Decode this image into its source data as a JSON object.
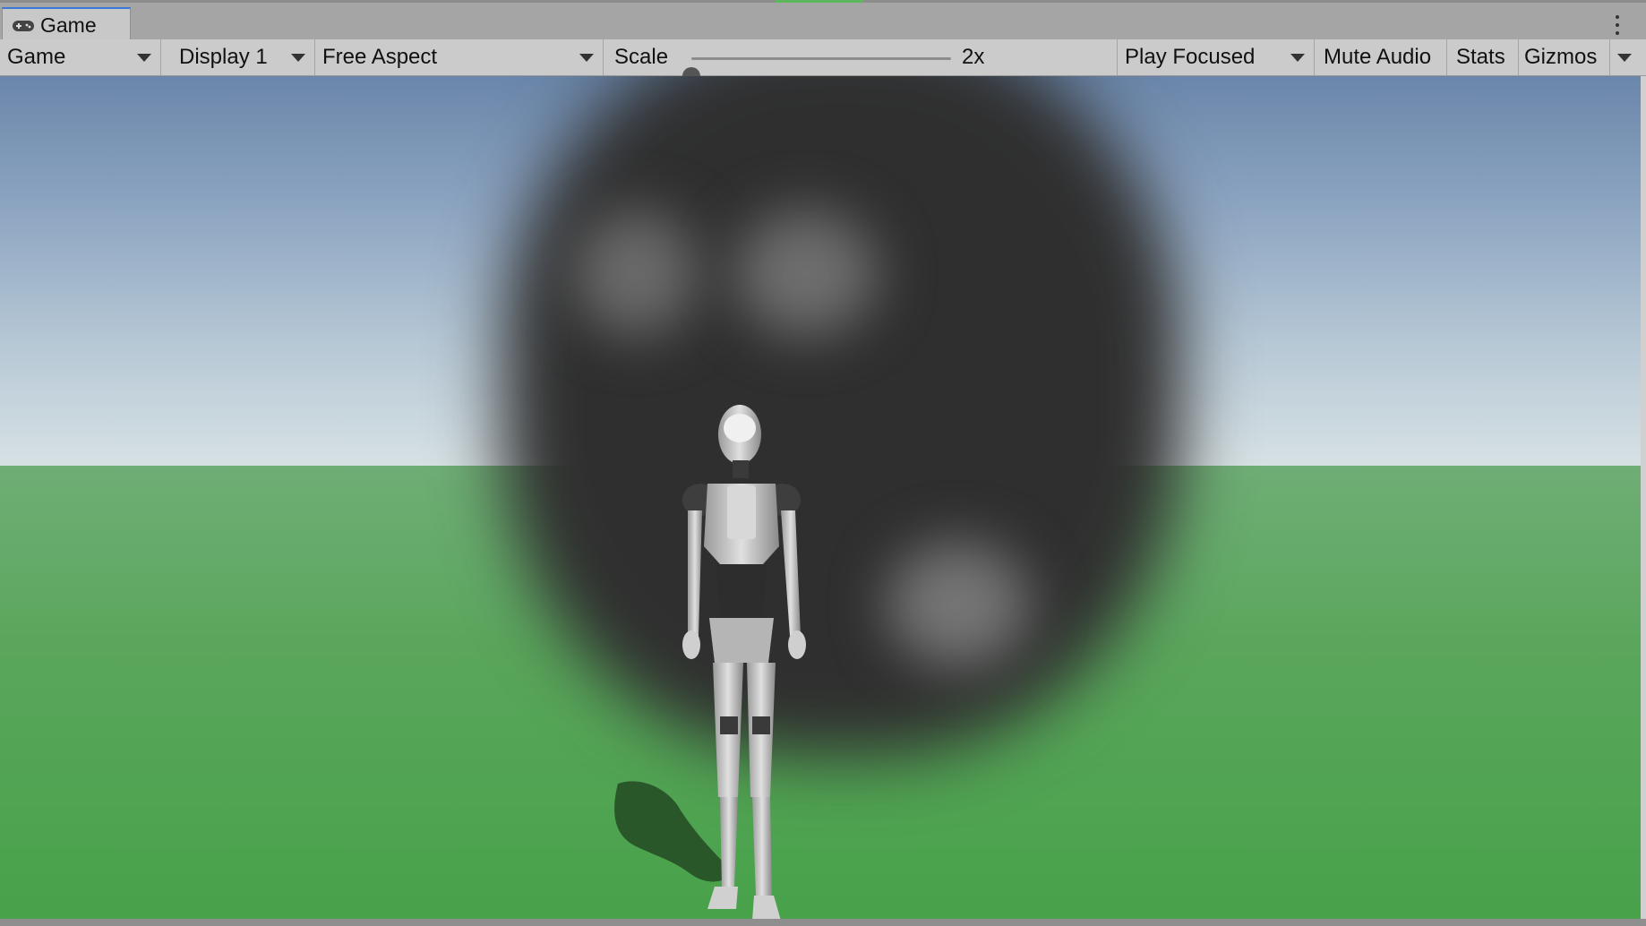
{
  "tab": {
    "label": "Game",
    "icon": "gamepad-icon"
  },
  "menu": {
    "icon": "kebab-menu-icon"
  },
  "toolbar": {
    "view_mode": "Game",
    "display": "Display 1",
    "aspect": "Free Aspect",
    "scale_label": "Scale",
    "scale_value": "2x",
    "scale_fraction": 0.0,
    "play_mode": "Play Focused",
    "mute_audio": "Mute Audio",
    "stats": "Stats",
    "gizmos": "Gizmos"
  },
  "colors": {
    "tab_accent": "#3a79d8",
    "sky_top": "#6a86aa",
    "sky_horizon": "#d6e1e4",
    "ground": "#5aa65c"
  }
}
